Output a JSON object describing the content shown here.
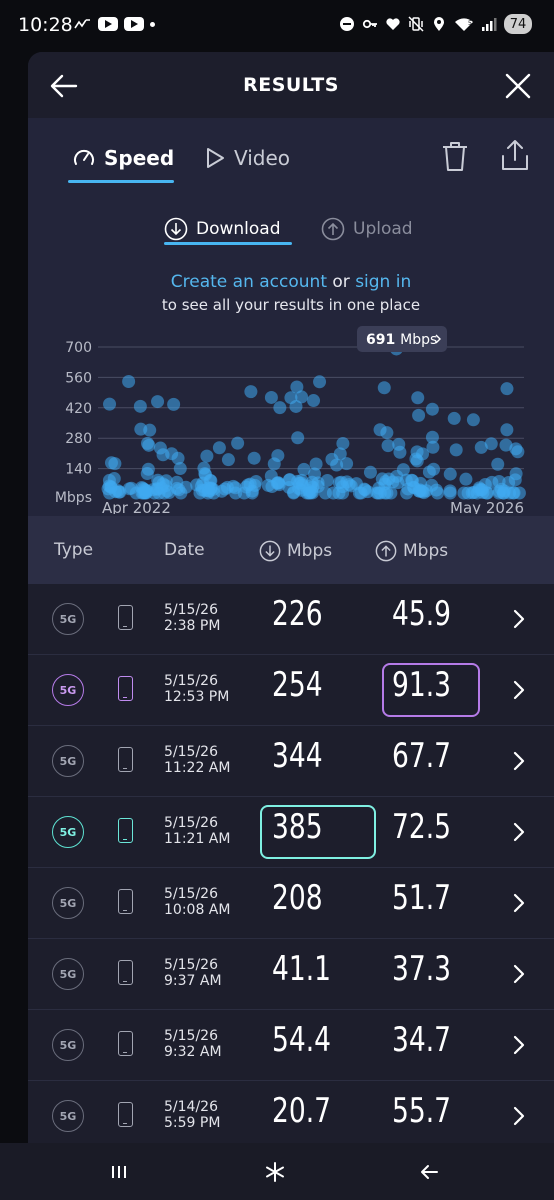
{
  "status_bar": {
    "time": "10:28",
    "battery": "74",
    "left_icons": [
      "missed-call-icon",
      "youtube-icon",
      "youtube-icon",
      "dot-icon"
    ],
    "right_icons": [
      "dnd-icon",
      "vpn-key-icon",
      "heart-icon",
      "vibrate-icon",
      "location-icon",
      "wifi-icon",
      "signal-icon"
    ]
  },
  "header": {
    "title": "RESULTS"
  },
  "tabs": [
    {
      "label": "Speed",
      "icon": "speedometer-icon",
      "active": true
    },
    {
      "label": "Video",
      "icon": "play-icon",
      "active": false
    }
  ],
  "segments": [
    {
      "label": "Download",
      "icon": "download-arrow-icon",
      "active": true
    },
    {
      "label": "Upload",
      "icon": "upload-arrow-icon",
      "active": false
    }
  ],
  "promo": {
    "create_account": "Create an account",
    "or": " or ",
    "sign_in": "sign in",
    "line2": "to see all your results in one place"
  },
  "chart_data": {
    "type": "scatter",
    "y_ticks": [
      "700",
      "560",
      "420",
      "280",
      "140"
    ],
    "y_unit": "Mbps",
    "ylim": [
      0,
      700
    ],
    "x_start_label": "Apr 2022",
    "x_end_label": "May 2026",
    "xlim": [
      "2022-04",
      "2026-05"
    ],
    "tooltip": {
      "value": "691",
      "unit": "Mbps"
    },
    "color": "#3fa9f0",
    "grid": true
  },
  "table": {
    "headers": {
      "type": "Type",
      "date": "Date",
      "download": "Mbps",
      "upload": "Mbps"
    },
    "rows": [
      {
        "network": "5G",
        "date": "5/15/26",
        "time": "2:38 PM",
        "download": "226",
        "upload": "45.9",
        "highlight": "none"
      },
      {
        "network": "5G",
        "date": "5/15/26",
        "time": "12:53 PM",
        "download": "254",
        "upload": "91.3",
        "highlight": "purple"
      },
      {
        "network": "5G",
        "date": "5/15/26",
        "time": "11:22 AM",
        "download": "344",
        "upload": "67.7",
        "highlight": "none"
      },
      {
        "network": "5G",
        "date": "5/15/26",
        "time": "11:21 AM",
        "download": "385",
        "upload": "72.5",
        "highlight": "cyan"
      },
      {
        "network": "5G",
        "date": "5/15/26",
        "time": "10:08 AM",
        "download": "208",
        "upload": "51.7",
        "highlight": "none"
      },
      {
        "network": "5G",
        "date": "5/15/26",
        "time": "9:37 AM",
        "download": "41.1",
        "upload": "37.3",
        "highlight": "none"
      },
      {
        "network": "5G",
        "date": "5/15/26",
        "time": "9:32 AM",
        "download": "54.4",
        "upload": "34.7",
        "highlight": "none"
      },
      {
        "network": "5G",
        "date": "5/14/26",
        "time": "5:59 PM",
        "download": "20.7",
        "upload": "55.7",
        "highlight": "none"
      }
    ]
  },
  "colors": {
    "accent": "#48b6f1",
    "purple_highlight": "#b57be8",
    "cyan_highlight": "#7ff0e2"
  },
  "navbar": [
    "recents-icon",
    "home-icon",
    "back-icon"
  ]
}
